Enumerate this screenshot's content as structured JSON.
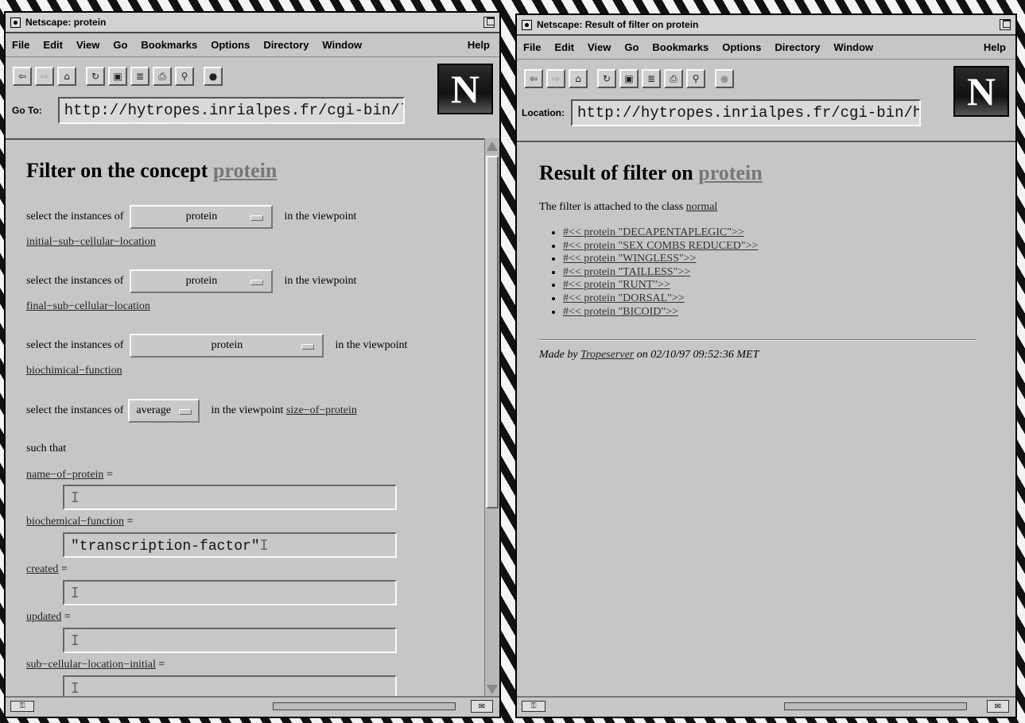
{
  "left": {
    "title": "Netscape: protein",
    "menu": [
      "File",
      "Edit",
      "View",
      "Go",
      "Bookmarks",
      "Options",
      "Directory",
      "Window"
    ],
    "help": "Help",
    "location_label": "Go To:",
    "url": "http://hytropes.inrialpes.fr/cgi-bin/l",
    "heading_prefix": "Filter on the concept",
    "heading_link": "protein",
    "select_prefix": "select the instances of",
    "in_viewpoint": "in the viewpoint",
    "in_viewpoint_inline": "in the viewpoint",
    "selects": [
      {
        "value": "protein",
        "viewpoint": "initial−sub−cellular−location"
      },
      {
        "value": "protein",
        "viewpoint": "final−sub−cellular−location"
      },
      {
        "value": "protein",
        "viewpoint": "biochimical−function"
      },
      {
        "value": "average",
        "viewpoint": "size−of−protein"
      }
    ],
    "such_that": "such that",
    "equals": "=",
    "fields": [
      {
        "name": "name−of−protein",
        "value": ""
      },
      {
        "name": "biochemical−function",
        "value": "\"transcription-factor\""
      },
      {
        "name": "created",
        "value": ""
      },
      {
        "name": "updated",
        "value": ""
      },
      {
        "name": "sub−cellular−location−initial",
        "value": ""
      }
    ]
  },
  "right": {
    "title": "Netscape: Result of filter on protein",
    "menu": [
      "File",
      "Edit",
      "View",
      "Go",
      "Bookmarks",
      "Options",
      "Directory",
      "Window"
    ],
    "help": "Help",
    "location_label": "Location:",
    "url": "http://hytropes.inrialpes.fr/cgi-bin/h",
    "heading_prefix": "Result of filter on",
    "heading_link": "protein",
    "attached_prefix": "The filter is attached to the class",
    "attached_class": "normal",
    "results": [
      "#<< protein \"DECAPENTAPLEGIC\">>",
      "#<< protein \"SEX COMBS REDUCED\">>",
      "#<< protein \"WINGLESS\">>",
      "#<< protein \"TAILLESS\">>",
      "#<< protein \"RUNT\">>",
      "#<< protein \"DORSAL\">>",
      "#<< protein \"BICOID\">>"
    ],
    "footer_prefix": "Made by",
    "footer_link": "Tropeserver",
    "footer_suffix": "on 02/10/97 09:52:36 MET"
  },
  "logo_letter": "N",
  "icons": [
    "back-icon",
    "forward-icon",
    "home-icon",
    "reload-icon",
    "images-icon",
    "open-icon",
    "print-icon",
    "find-icon",
    "stop-icon",
    "netscape-logo",
    "security-key-icon",
    "mail-icon"
  ]
}
